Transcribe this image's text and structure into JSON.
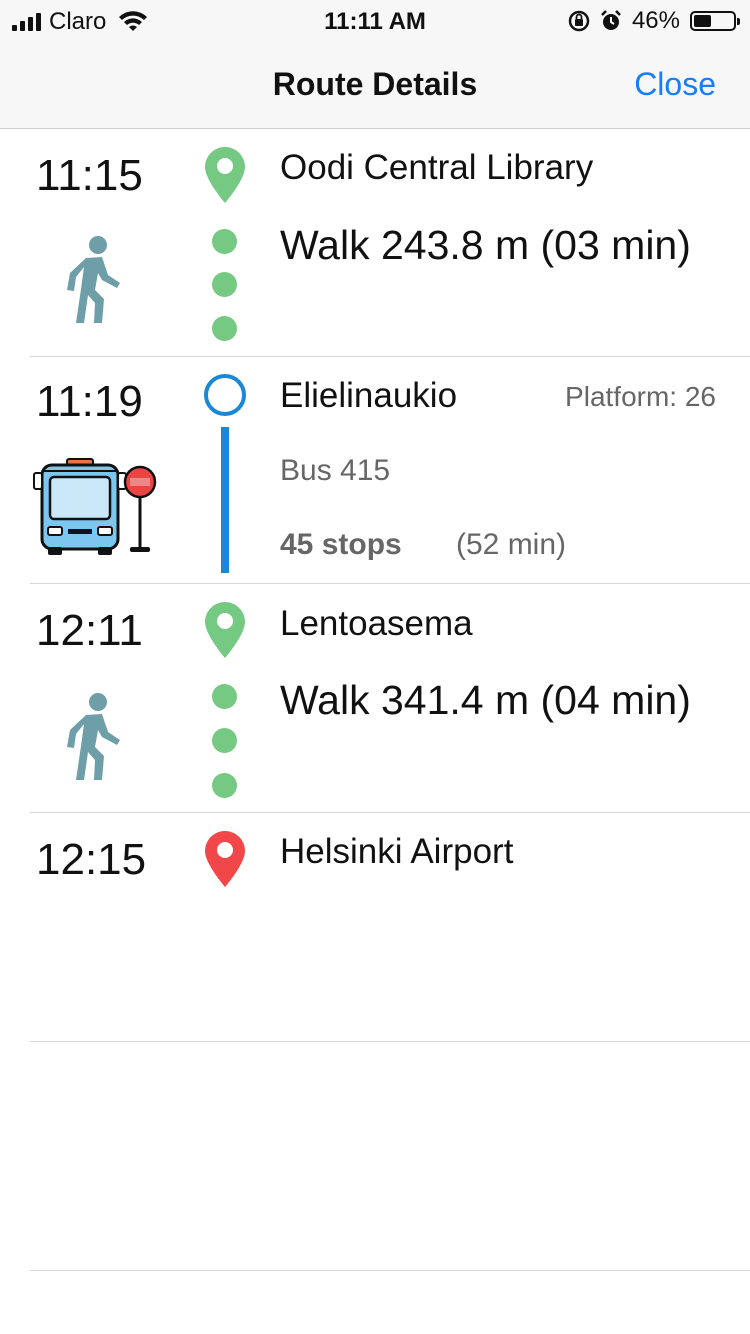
{
  "status_bar": {
    "carrier": "Claro",
    "time": "11:11 AM",
    "battery": "46%",
    "battery_level": 0.46,
    "icons": [
      "signal-icon",
      "wifi-icon",
      "rotation-lock-icon",
      "alarm-icon",
      "battery-icon"
    ]
  },
  "nav": {
    "title": "Route Details",
    "close_label": "Close"
  },
  "colors": {
    "accent": "#147efb",
    "walk_green": "#75c983",
    "bus_blue": "#1b88d6",
    "destination_red": "#f04848",
    "walker_teal": "#6e9ea8"
  },
  "legs": [
    {
      "time": "11:15",
      "place": "Oodi Central Library",
      "detail": "Walk 243.8 m (03 min)",
      "mode": "walk"
    },
    {
      "time": "11:19",
      "place": "Elielinaukio",
      "platform": "Platform: 26",
      "line": "Bus 415",
      "stops": "45 stops",
      "duration": "(52 min)",
      "mode": "bus"
    },
    {
      "time": "12:11",
      "place": "Lentoasema",
      "detail": "Walk 341.4 m (04 min)",
      "mode": "walk"
    },
    {
      "time": "12:15",
      "place": "Helsinki Airport",
      "mode": "destination"
    }
  ]
}
